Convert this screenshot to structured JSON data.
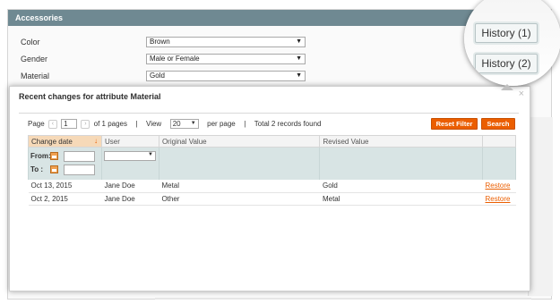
{
  "panel": {
    "title": "Accessories",
    "attributes": [
      {
        "label": "Color",
        "value": "Brown"
      },
      {
        "label": "Gender",
        "value": "Male or Female"
      },
      {
        "label": "Material",
        "value": "Gold"
      }
    ]
  },
  "modal": {
    "title": "Recent changes for attribute Material",
    "close_glyph": "×",
    "pager": {
      "page_label": "Page",
      "page_value": "1",
      "of_pages": "of 1 pages",
      "separator": "|",
      "view_label": "View",
      "view_value": "20",
      "per_page": "per page",
      "total": "Total 2 records found"
    },
    "buttons": {
      "reset": "Reset Filter",
      "search": "Search"
    },
    "columns": [
      "Change date",
      "User",
      "Original Value",
      "Revised Value",
      ""
    ],
    "filter": {
      "from_label": "From:",
      "to_label": "To :"
    },
    "rows": [
      {
        "date": "Oct 13, 2015",
        "user": "Jane Doe",
        "original": "Metal",
        "revised": "Gold",
        "action": "Restore"
      },
      {
        "date": "Oct 2, 2015",
        "user": "Jane Doe",
        "original": "Other",
        "revised": "Metal",
        "action": "Restore"
      }
    ]
  },
  "history": {
    "btn1": "History (1)",
    "btn2": "History (2)"
  },
  "colors": {
    "accent": "#eb5e00",
    "header": "#6f8992",
    "filter_row": "#d8e4e4"
  }
}
